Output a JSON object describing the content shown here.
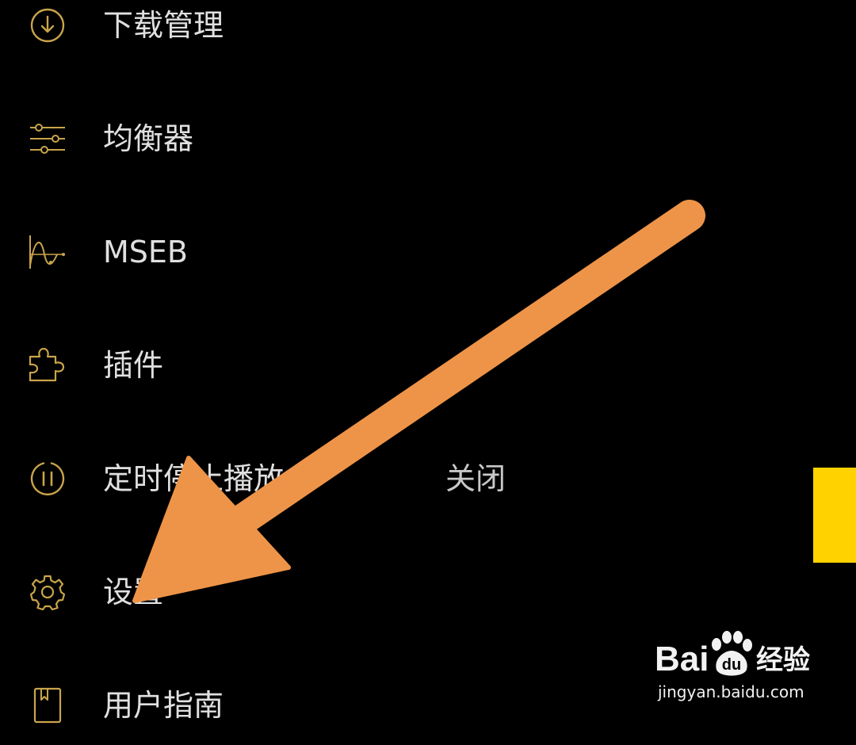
{
  "menu": {
    "items": [
      {
        "label": "下载管理",
        "icon": "download-icon"
      },
      {
        "label": "均衡器",
        "icon": "equalizer-icon"
      },
      {
        "label": "MSEB",
        "icon": "mseb-wave-icon"
      },
      {
        "label": "插件",
        "icon": "puzzle-icon"
      },
      {
        "label": "定时停止播放",
        "icon": "timer-pause-icon",
        "value": "关闭"
      },
      {
        "label": "设置",
        "icon": "gear-icon"
      },
      {
        "label": "用户指南",
        "icon": "book-icon"
      }
    ]
  },
  "watermark": {
    "brand": "Bai",
    "brand_suffix": "du",
    "product": "经验",
    "url": "jingyan.baidu.com"
  },
  "colors": {
    "background": "#000000",
    "icon_gold": "#c9a44a",
    "label": "#e0e0e0",
    "arrow": "#ee9448",
    "side_tab": "#ffd200"
  }
}
